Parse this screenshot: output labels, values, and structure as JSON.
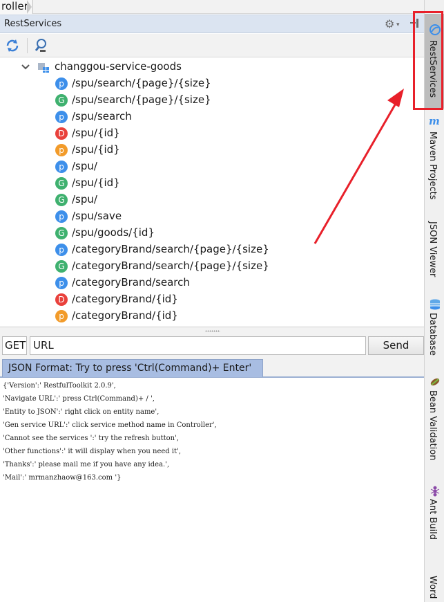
{
  "breadcrumb": {
    "label": "roller"
  },
  "tool_window": {
    "title": "RestServices"
  },
  "toolbar": {
    "buttons": [
      "refresh-icon",
      "find-icon"
    ]
  },
  "tree": {
    "root": "changgou-service-goods",
    "items": [
      {
        "method": "p",
        "color": "#3d8fea",
        "path": "/spu/search/{page}/{size}"
      },
      {
        "method": "G",
        "color": "#3fb16f",
        "path": "/spu/search/{page}/{size}"
      },
      {
        "method": "p",
        "color": "#3d8fea",
        "path": "/spu/search"
      },
      {
        "method": "D",
        "color": "#e9413c",
        "path": "/spu/{id}"
      },
      {
        "method": "p",
        "color": "#f29b2a",
        "path": "/spu/{id}"
      },
      {
        "method": "p",
        "color": "#3d8fea",
        "path": "/spu/"
      },
      {
        "method": "G",
        "color": "#3fb16f",
        "path": "/spu/{id}"
      },
      {
        "method": "G",
        "color": "#3fb16f",
        "path": "/spu/"
      },
      {
        "method": "p",
        "color": "#3d8fea",
        "path": "/spu/save"
      },
      {
        "method": "G",
        "color": "#3fb16f",
        "path": "/spu/goods/{id}"
      },
      {
        "method": "p",
        "color": "#3d8fea",
        "path": "/categoryBrand/search/{page}/{size}"
      },
      {
        "method": "G",
        "color": "#3fb16f",
        "path": "/categoryBrand/search/{page}/{size}"
      },
      {
        "method": "p",
        "color": "#3d8fea",
        "path": "/categoryBrand/search"
      },
      {
        "method": "D",
        "color": "#e9413c",
        "path": "/categoryBrand/{id}"
      },
      {
        "method": "p",
        "color": "#f29b2a",
        "path": "/categoryBrand/{id}"
      }
    ]
  },
  "request": {
    "method": "GET",
    "url": "URL",
    "send_label": "Send"
  },
  "tab": {
    "label": "JSON Format: Try to press 'Ctrl(Command)+ Enter'"
  },
  "json_lines": [
    "{'Version':' RestfulToolkit 2.0.9',",
    "'Navigate URL':' press Ctrl(Command)+ / ',",
    "'Entity to JSON':' right click on entity name',",
    "'Gen service URL':' click service method name in Controller',",
    "'Cannot see the services ':' try the refresh button',",
    "'Other functions':' it will display when you need it',",
    "'Thanks':' please mail me if you have any idea.',",
    "'Mail':' mrmanzhaow@163.com '}"
  ],
  "right_stripe": [
    {
      "label": "RestServices",
      "icon": "rest-services-icon",
      "active": true
    },
    {
      "label": "Maven Projects",
      "icon": "maven-icon",
      "active": false
    },
    {
      "label": "JSON Viewer",
      "icon": "",
      "active": false
    },
    {
      "label": "Database",
      "icon": "database-icon",
      "active": false
    },
    {
      "label": "Bean Validation",
      "icon": "bean-validation-icon",
      "active": false
    },
    {
      "label": "Ant Build",
      "icon": "ant-icon",
      "active": false
    },
    {
      "label": "Word",
      "icon": "",
      "active": false
    }
  ],
  "colors": {
    "annotation": "#e8202a",
    "header": "#dbe4f1",
    "tab": "#a8bde2"
  }
}
